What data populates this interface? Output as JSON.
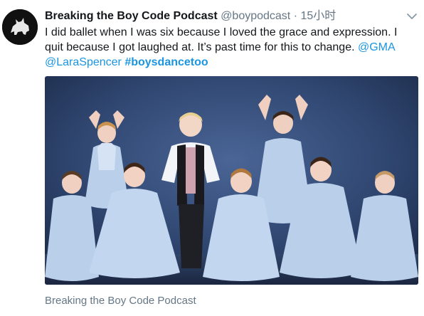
{
  "tweet": {
    "author_name": "Breaking the Boy Code Podcast",
    "handle": "@boypodcast",
    "separator": "·",
    "time": "15小时",
    "text_plain": "I did ballet when I was six because I loved the grace and expression. I quit because I got laughed at. It’s past time for this to change. ",
    "mention_gma": "@GMA",
    "mention_lara": "@LaraSpencer",
    "hashtag": "#boysdancetoo",
    "media_caption": "Breaking the Boy Code Podcast"
  },
  "icons": {
    "avatar": "wolf-logo-icon",
    "menu": "chevron-down-icon"
  },
  "colors": {
    "link": "#1b95e0",
    "text": "#14171a",
    "muted": "#657786",
    "photo_backdrop": "#2f4670",
    "tutu": "#b9cfea"
  }
}
